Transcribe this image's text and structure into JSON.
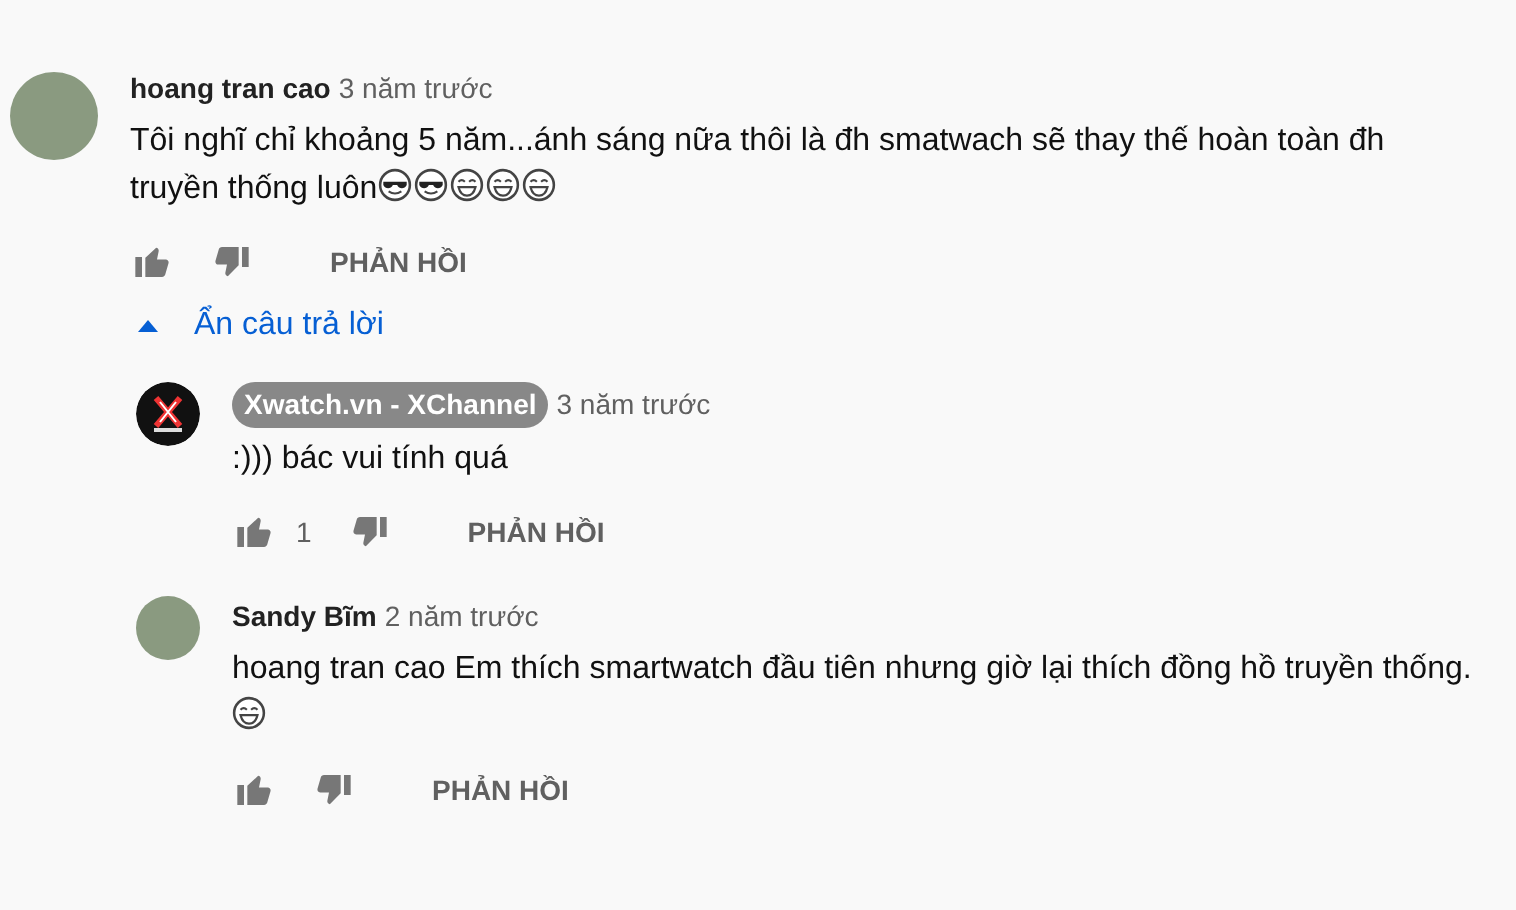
{
  "comment": {
    "author": "hoang tran cao",
    "owner": false,
    "time": "3 năm trước",
    "avatar": {
      "kind": "photo"
    },
    "text": "Tôi nghĩ chỉ khoảng 5 năm...ánh sáng nữa thôi là đh smatwach sẽ thay thế hoàn toàn đh truyền thống luôn",
    "emojis": [
      {
        "kind": "cool"
      },
      {
        "kind": "cool"
      },
      {
        "kind": "laugh"
      },
      {
        "kind": "laugh"
      },
      {
        "kind": "laugh"
      }
    ],
    "reply_button": "PHẢN HỒI"
  },
  "toggle": {
    "label": "Ẩn câu trả lời",
    "expanded": true
  },
  "replies": [
    {
      "author": "Xwatch.vn - XChannel",
      "owner": true,
      "time": "3 năm trước",
      "avatar": {
        "kind": "logo"
      },
      "text": ":))) bác vui tính quá",
      "likes": "1",
      "reply_button": "PHẢN HỒI"
    },
    {
      "author": "Sandy Bĩm",
      "owner": false,
      "time": "2 năm trước",
      "avatar": {
        "kind": "photo"
      },
      "text": "hoang tran cao Em thích smartwatch đầu tiên nhưng giờ lại thích đồng hồ truyền thống.",
      "emojis": [
        {
          "kind": "laugh"
        }
      ],
      "reply_button": "PHẢN HỒI"
    }
  ]
}
